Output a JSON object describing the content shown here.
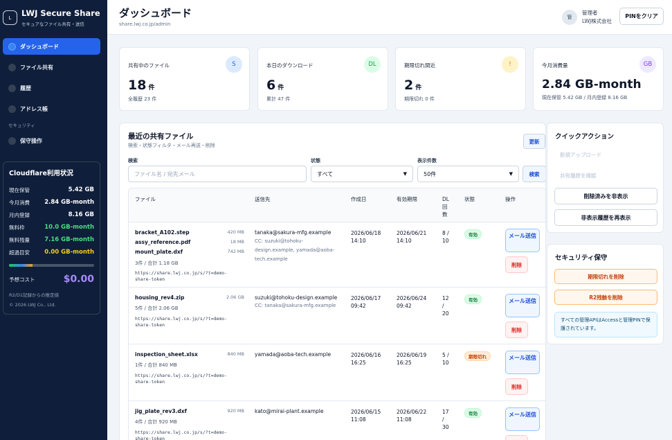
{
  "brand": {
    "title": "LWJ Secure Share",
    "subtitle": "セキュアなファイル共有・送信",
    "logo": "L"
  },
  "nav": {
    "items": [
      {
        "label": "ダッシュボード",
        "active": true
      },
      {
        "label": "ファイル共有"
      },
      {
        "label": "履歴"
      },
      {
        "label": "アドレス帳"
      }
    ],
    "section_label": "セキュリティ",
    "security_items": [
      {
        "label": "保守操作"
      }
    ]
  },
  "cloudflare": {
    "title": "Cloudflare利用状況",
    "rows": [
      {
        "label": "現在保管",
        "value": "5.42 GB"
      },
      {
        "label": "今月消費",
        "value": "2.84 GB-month"
      },
      {
        "label": "月内登録",
        "value": "8.16 GB"
      },
      {
        "label": "無料枠",
        "value": "10.0 GB-month",
        "color": "#4ade80"
      },
      {
        "label": "無料残量",
        "value": "7.16 GB-month",
        "color": "#4ade80"
      },
      {
        "label": "超過目安",
        "value": "0.00 GB-month",
        "color": "#facc15"
      }
    ],
    "usage_fraction": 0.28,
    "cost_label": "予想コスト",
    "cost_value": "$0.00",
    "note": "R2/D1記録からの推定値",
    "copyright": "© 2026 LWJ Co., Ltd."
  },
  "header": {
    "title": "ダッシュボード",
    "url": "share.lwj.co.jp/admin",
    "avatar": "管",
    "user_role": "管理者",
    "user_org": "LWJ株式会社",
    "pin_button": "PINをクリア"
  },
  "stats": [
    {
      "label": "共有中のファイル",
      "value": "18",
      "unit": "件",
      "sub": "全履歴 23 件",
      "icon": "S",
      "icon_bg": "#dbeafe",
      "icon_color": "#2563eb"
    },
    {
      "label": "本日のダウンロード",
      "value": "6",
      "unit": "件",
      "sub": "累計 47 件",
      "icon": "DL",
      "icon_bg": "#dcfce7",
      "icon_color": "#16a34a"
    },
    {
      "label": "期限切れ間近",
      "value": "2",
      "unit": "件",
      "sub": "期限切れ 0 件",
      "icon": "!",
      "icon_bg": "#fef3c7",
      "icon_color": "#d97706"
    },
    {
      "label": "今月消費量",
      "value": "2.84 GB-month",
      "unit": "",
      "sub": "現在保管 5.42 GB / 月内登録 8.16 GB",
      "icon": "GB",
      "icon_bg": "#ede9fe",
      "icon_color": "#7c3aed"
    }
  ],
  "files": {
    "title": "最近の共有ファイル",
    "subtitle": "検索・状態フィルタ・メール再送・削除",
    "refresh": "更新",
    "search_label": "検索",
    "search_placeholder": "ファイル名 / 宛先メール",
    "status_label": "状態",
    "status_value": "すべて",
    "count_label": "表示件数",
    "count_value": "50件",
    "search_button": "検索",
    "columns": {
      "file": "ファイル",
      "to": "送信先",
      "created": "作成日",
      "expires": "有効期限",
      "dl": "DL回数",
      "status": "状態",
      "actions": "操作"
    },
    "mail_button": "メール送信",
    "delete_button": "削除",
    "rows": [
      {
        "files": [
          {
            "name": "bracket_A102.step",
            "size": "420 MB"
          },
          {
            "name": "assy_reference.pdf",
            "size": "18 MB"
          },
          {
            "name": "mount_plate.dxf",
            "size": "742 MB"
          }
        ],
        "summary": "3件 / 合計 1.18 GB",
        "link": "https://share.lwj.co.jp/s/?t=demo-share-token",
        "to": "tanaka@sakura-mfg.example",
        "cc": "CC: suzuki@tohoku-design.example, yamada@aoba-tech.example",
        "created": "2026/06/18 14:10",
        "expires": "2026/06/21 14:10",
        "dl": "8 / 10",
        "status": "有効",
        "status_type": "ok"
      },
      {
        "files": [
          {
            "name": "housing_rev4.zip",
            "size": "2.06 GB"
          }
        ],
        "summary": "5件 / 合計 2.06 GB",
        "link": "https://share.lwj.co.jp/s/?t=demo-share-token",
        "to": "suzuki@tohoku-design.example",
        "cc": "CC: tanaka@sakura-mfg.example",
        "created": "2026/06/17 09:42",
        "expires": "2026/06/24 09:42",
        "dl": "12 / 20",
        "status": "有効",
        "status_type": "ok"
      },
      {
        "files": [
          {
            "name": "inspection_sheet.xlsx",
            "size": "840 MB"
          }
        ],
        "summary": "1件 / 合計 840 MB",
        "link": "https://share.lwj.co.jp/s/?t=demo-share-token",
        "to": "yamada@aoba-tech.example",
        "cc": "",
        "created": "2026/06/16 16:25",
        "expires": "2026/06/19 16:25",
        "dl": "5 / 10",
        "status": "期限切れ",
        "status_type": "exp"
      },
      {
        "files": [
          {
            "name": "jig_plate_rev3.dxf",
            "size": "920 MB"
          }
        ],
        "summary": "4件 / 合計 920 MB",
        "link": "https://share.lwj.co.jp/s/?t=demo-share-token",
        "to": "kato@mirai-plant.example",
        "cc": "",
        "created": "2026/06/15 11:08",
        "expires": "2026/06/22 11:08",
        "dl": "17 / 30",
        "status": "有効",
        "status_type": "ok"
      }
    ]
  },
  "quick": {
    "title": "クイックアクション",
    "disabled": [
      "新規アップロード",
      "共有履歴を確認"
    ],
    "buttons": [
      "削除済みを非表示",
      "非表示履歴を再表示"
    ]
  },
  "security": {
    "title": "セキュリティ保守",
    "buttons": [
      "期限切れを削除",
      "R2残骸を削除"
    ],
    "note": "すべての管理APIはAccessと管理PINで保護されています。"
  }
}
